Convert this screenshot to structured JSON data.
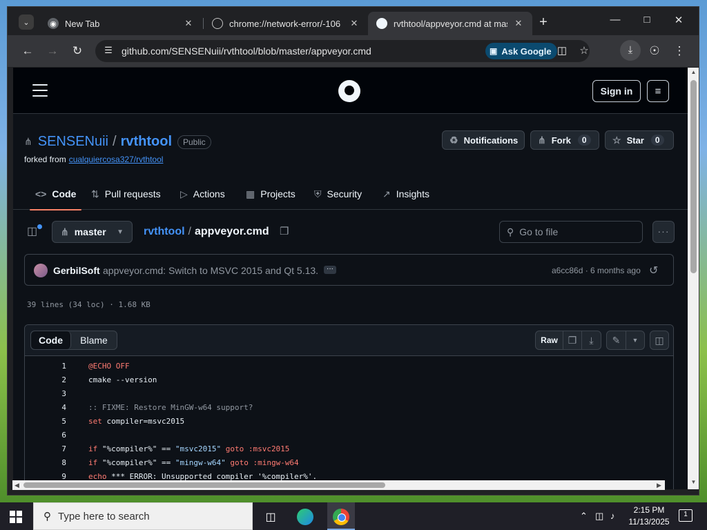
{
  "browser": {
    "tabs": [
      {
        "title": "New Tab",
        "favicon": "chrome-icon",
        "active": false
      },
      {
        "title": "chrome://network-error/-106",
        "favicon": "globe-icon",
        "active": false
      },
      {
        "title": "rvthtool/appveyor.cmd at master",
        "favicon": "github-icon",
        "active": true
      }
    ],
    "url": "github.com/SENSENuii/rvthtool/blob/master/appveyor.cmd",
    "ask_google": "Ask Google"
  },
  "github": {
    "header": {
      "sign_in": "Sign in"
    },
    "repo": {
      "owner": "SENSENuii",
      "name": "rvthtool",
      "visibility": "Public",
      "forked_from_label": "forked from",
      "forked_from": "cualquiercosa327/rvthtool",
      "notifications_label": "Notifications",
      "fork_label": "Fork",
      "fork_count": "0",
      "star_label": "Star",
      "star_count": "0"
    },
    "nav": [
      {
        "label": "Code",
        "icon": "code-icon",
        "active": true
      },
      {
        "label": "Pull requests",
        "icon": "pull-request-icon",
        "active": false
      },
      {
        "label": "Actions",
        "icon": "play-icon",
        "active": false
      },
      {
        "label": "Projects",
        "icon": "table-icon",
        "active": false
      },
      {
        "label": "Security",
        "icon": "shield-icon",
        "active": false
      },
      {
        "label": "Insights",
        "icon": "graph-icon",
        "active": false
      }
    ],
    "file": {
      "branch": "master",
      "breadcrumb_repo": "rvthtool",
      "breadcrumb_sep": "/",
      "filename": "appveyor.cmd",
      "goto_placeholder": "Go to file",
      "commit_author": "GerbilSoft",
      "commit_message": "appveyor.cmd: Switch to MSVC 2015 and Qt 5.13.",
      "commit_sha": "a6cc86d",
      "commit_time": "6 months ago",
      "stats": "39 lines (34 loc) · 1.68 KB",
      "view_code": "Code",
      "view_blame": "Blame",
      "raw_label": "Raw"
    },
    "code_lines": [
      {
        "n": "1"
      },
      {
        "n": "2"
      },
      {
        "n": "3"
      },
      {
        "n": "4"
      },
      {
        "n": "5"
      },
      {
        "n": "6"
      },
      {
        "n": "7"
      },
      {
        "n": "8"
      },
      {
        "n": "9"
      }
    ],
    "code_tokens": {
      "l1": "@ECHO OFF",
      "l2": "cmake --version",
      "l4": ":: FIXME: Restore MinGW-w64 support?",
      "l5_kw": "set",
      "l5_rest": " compiler=msvc2015",
      "l7_if": "if",
      "l7_a": " \"%compiler%\" == ",
      "l7_s": "\"msvc2015\"",
      "l7_goto": " goto",
      "l7_lbl": " :msvc2015",
      "l8_if": "if",
      "l8_a": " \"%compiler%\" == ",
      "l8_s": "\"mingw-w64\"",
      "l8_goto": " goto",
      "l8_lbl": " :mingw-w64",
      "l9_kw": "echo",
      "l9_rest": " *** ERROR: Unsupported compiler '%compiler%'."
    }
  },
  "taskbar": {
    "search_placeholder": "Type here to search",
    "time": "2:15 PM",
    "date": "11/13/2025",
    "notification_count": "1"
  },
  "colors": {
    "accent_link": "#4493f8",
    "nav_underline": "#f78166",
    "keyword": "#ff7b72",
    "ask_google_bg": "#0b4a6f"
  }
}
